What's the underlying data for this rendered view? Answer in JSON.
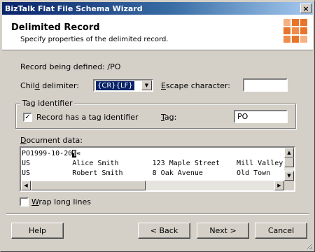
{
  "window": {
    "title": "BizTalk Flat File Schema Wizard",
    "close_glyph": "×"
  },
  "header": {
    "title": "Delimited Record",
    "subtitle": "Specify properties of the delimited record.",
    "logo_icon": "biztalk-orange-grid-logo"
  },
  "record": {
    "label": "Record being defined: /PO"
  },
  "child_delimiter": {
    "label": "Child delimiter:",
    "access_key": "d",
    "value": "{CR}{LF}",
    "dropdown_icon": "chevron-down-icon"
  },
  "escape_character": {
    "label": "Escape character:",
    "access_key": "E",
    "value": ""
  },
  "tag_identifier": {
    "group_label": "Tag identifier",
    "checkbox_label": "Record has a tag identifier",
    "checked": true,
    "check_glyph": "✓",
    "tag_label": "Tag:",
    "tag_access_key": "T",
    "tag_value": "PO"
  },
  "document_data": {
    "label": "Document data:",
    "access_key": "D",
    "lines": [
      {
        "text": "PO1999-10-20",
        "cursor": "¶",
        "after": "«"
      },
      {
        "text": "US          Alice Smith        123 Maple Street    Mill Valley"
      },
      {
        "text": "US          Robert Smith       8 Oak Avenue        Old Town"
      }
    ]
  },
  "wrap_long_lines": {
    "label": "Wrap long lines",
    "access_key": "W",
    "checked": false
  },
  "buttons": {
    "help": "Help",
    "back": "< Back",
    "next": "Next >",
    "cancel": "Cancel"
  },
  "colors": {
    "title_bar": "#0a246a",
    "selection": "#0a246a",
    "logo_orange": "#e8742a",
    "face": "#d4d0c8"
  }
}
